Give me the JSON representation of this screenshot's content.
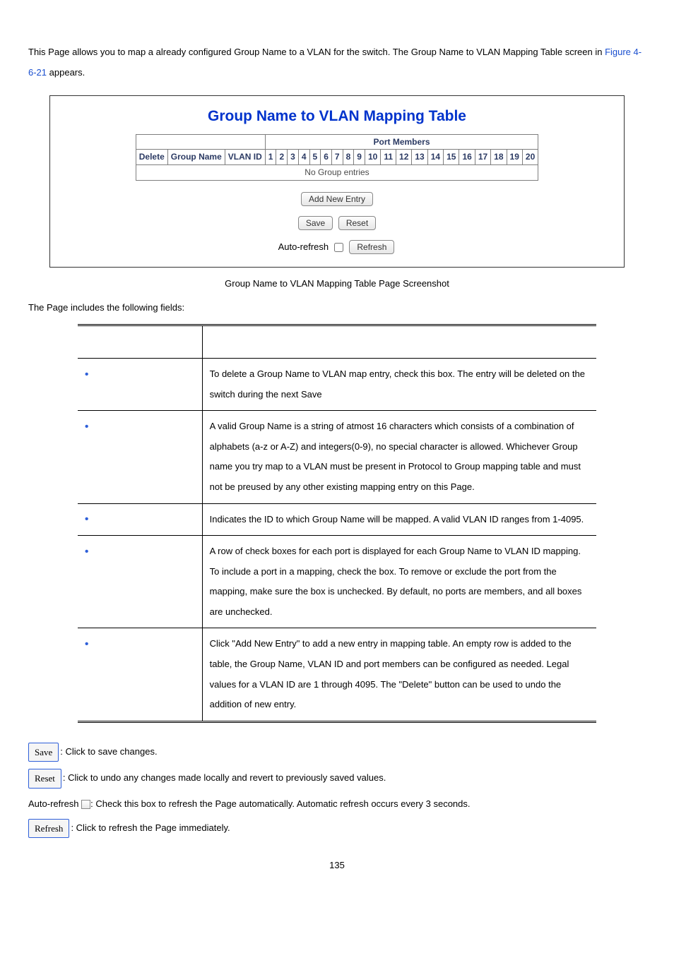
{
  "intro": {
    "prefix": "This Page allows you to map a already configured Group Name to a VLAN for the switch. The Group Name to VLAN Mapping Table screen in ",
    "link": "Figure 4-6-21",
    "suffix": " appears."
  },
  "screenshot": {
    "title": "Group Name to VLAN Mapping Table",
    "headers": {
      "port_members": "Port Members",
      "delete": "Delete",
      "group_name": "Group Name",
      "vlan_id": "VLAN ID",
      "ports": [
        "1",
        "2",
        "3",
        "4",
        "5",
        "6",
        "7",
        "8",
        "9",
        "10",
        "11",
        "12",
        "13",
        "14",
        "15",
        "16",
        "17",
        "18",
        "19",
        "20"
      ]
    },
    "no_entries": "No Group entries",
    "buttons": {
      "add_new": "Add New Entry",
      "save": "Save",
      "reset": "Reset",
      "auto_refresh_label": "Auto-refresh",
      "refresh": "Refresh"
    }
  },
  "caption": "Group Name to VLAN Mapping Table Page Screenshot",
  "section_label": "The Page includes the following fields:",
  "fields": [
    {
      "object": "",
      "desc": "To delete a Group Name to VLAN map entry, check this box. The entry will be deleted on the switch during the next Save"
    },
    {
      "object": "",
      "desc": "A valid Group Name is a string of atmost 16 characters which consists of a combination of alphabets (a-z or A-Z) and integers(0-9), no special character is allowed. Whichever Group name you try map to a VLAN must be present in Protocol to Group mapping table and must not be preused by any other existing mapping entry on this Page."
    },
    {
      "object": "",
      "desc": "Indicates the ID to which Group Name will be mapped. A valid VLAN ID ranges from 1-4095."
    },
    {
      "object": "",
      "desc": "A row of check boxes for each port is displayed for each Group Name to VLAN ID mapping. To include a port in a mapping, check the box. To remove or exclude the port from the mapping, make sure the box is unchecked. By default, no ports are members, and all boxes are unchecked."
    },
    {
      "object": "",
      "desc": "Click \"Add New Entry\" to add a new entry in mapping table. An empty row is added to the table, the Group Name, VLAN ID and port members can be configured as needed. Legal values for a VLAN ID are 1 through 4095. The \"Delete\" button can be used to undo the addition of new entry."
    }
  ],
  "legend": {
    "save": {
      "btn": "Save",
      "text": ": Click to save changes."
    },
    "reset": {
      "btn": "Reset",
      "text": ": Click to undo any changes made locally and revert to previously saved values."
    },
    "auto_refresh": {
      "prefix": "Auto-refresh ",
      "text": ": Check this box to refresh the Page automatically. Automatic refresh occurs every 3 seconds."
    },
    "refresh": {
      "btn": "Refresh",
      "text": ": Click to refresh the Page immediately."
    }
  },
  "page_number": "135"
}
